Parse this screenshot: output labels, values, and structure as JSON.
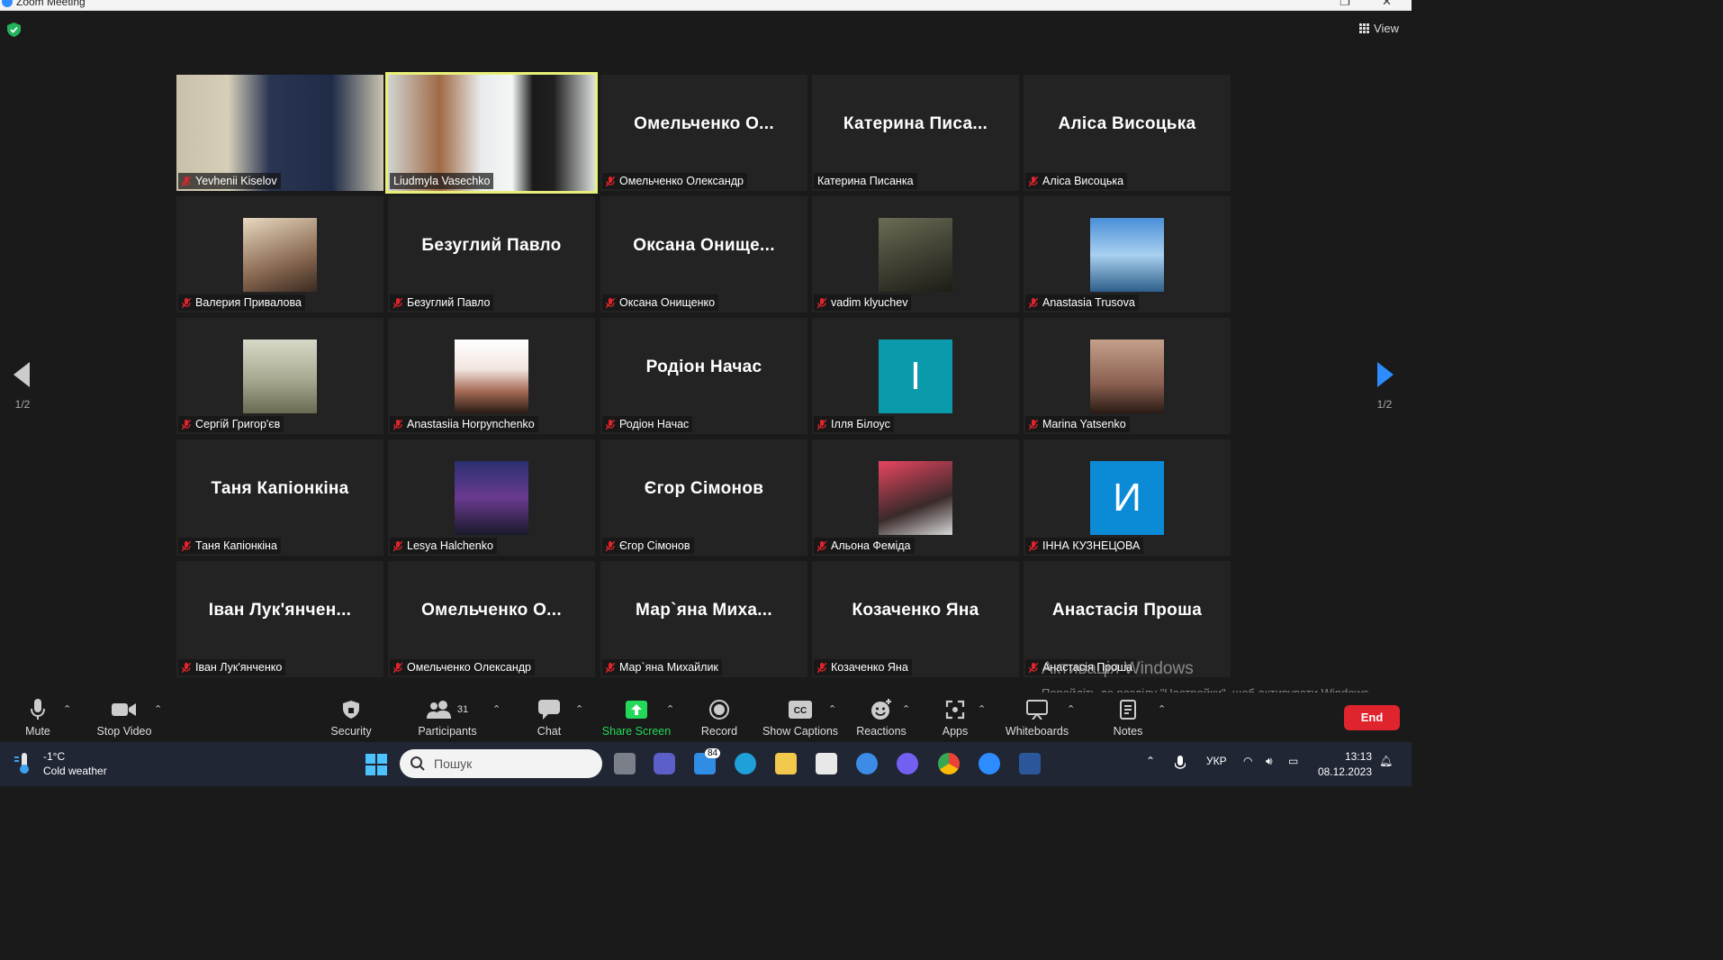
{
  "window": {
    "title": "Zoom Meeting"
  },
  "view_button": {
    "label": "View"
  },
  "pagination": {
    "left": "1/2",
    "right": "1/2"
  },
  "tiles": [
    {
      "display_name": "",
      "label": "Yevhenii Kiselov",
      "muted": true,
      "type": "video"
    },
    {
      "display_name": "",
      "label": "Liudmyla Vasechko",
      "muted": false,
      "type": "video",
      "active": true
    },
    {
      "display_name": "Омельченко  О...",
      "label": "Омельченко Олександр",
      "muted": true,
      "type": "name"
    },
    {
      "display_name": "Катерина  Писа...",
      "label": "Катерина Писанка",
      "muted": false,
      "type": "name"
    },
    {
      "display_name": "Аліса Висоцька",
      "label": "Аліса Висоцька",
      "muted": true,
      "type": "name"
    },
    {
      "display_name": "",
      "label": "Валерия Привалова",
      "muted": true,
      "type": "photo"
    },
    {
      "display_name": "Безуглий Павло",
      "label": "Безуглий Павло",
      "muted": true,
      "type": "name"
    },
    {
      "display_name": "Оксана  Онище...",
      "label": "Оксана Онищенко",
      "muted": true,
      "type": "name"
    },
    {
      "display_name": "",
      "label": "vadim klyuchev",
      "muted": true,
      "type": "photo"
    },
    {
      "display_name": "",
      "label": "Anastasia Trusova",
      "muted": true,
      "type": "photo"
    },
    {
      "display_name": "",
      "label": "Сергій Григор'єв",
      "muted": true,
      "type": "photo"
    },
    {
      "display_name": "",
      "label": "Anastasiia Horpynchenko",
      "muted": true,
      "type": "photo"
    },
    {
      "display_name": "Родіон Начас",
      "label": "Родіон Начас",
      "muted": true,
      "type": "name"
    },
    {
      "display_name": "І",
      "label": "Ілля Білоус",
      "muted": true,
      "type": "letter",
      "color": "#0a9aac"
    },
    {
      "display_name": "",
      "label": "Marina Yatsenko",
      "muted": true,
      "type": "photo"
    },
    {
      "display_name": "Таня Капіонкіна",
      "label": "Таня Капіонкіна",
      "muted": true,
      "type": "name"
    },
    {
      "display_name": "",
      "label": "Lesya Halchenko",
      "muted": true,
      "type": "photo"
    },
    {
      "display_name": "Єгор Сімонов",
      "label": "Єгор Сімонов",
      "muted": true,
      "type": "name"
    },
    {
      "display_name": "",
      "label": "Альона Феміда",
      "muted": true,
      "type": "photo"
    },
    {
      "display_name": "И",
      "label": "ІННА КУЗНЕЦОВА",
      "muted": true,
      "type": "letter",
      "color": "#0b8ad6"
    },
    {
      "display_name": "Іван  Лук'янчен...",
      "label": "Іван Лук'янченко",
      "muted": true,
      "type": "name"
    },
    {
      "display_name": "Омельченко  О...",
      "label": "Омельченко Олександр",
      "muted": true,
      "type": "name"
    },
    {
      "display_name": "Мар`яна  Миха...",
      "label": "Мар`яна Михайлик",
      "muted": true,
      "type": "name"
    },
    {
      "display_name": "Козаченко Яна",
      "label": "Козаченко Яна",
      "muted": true,
      "type": "name"
    },
    {
      "display_name": "Анастасія Проша",
      "label": "Анастасія Проша",
      "muted": true,
      "type": "name"
    }
  ],
  "toolbar": {
    "mute": "Mute",
    "stop_video": "Stop Video",
    "security": "Security",
    "participants": "Participants",
    "participants_count": "31",
    "chat": "Chat",
    "share_screen": "Share Screen",
    "record": "Record",
    "show_captions": "Show Captions",
    "reactions": "Reactions",
    "apps": "Apps",
    "whiteboards": "Whiteboards",
    "notes": "Notes",
    "end": "End"
  },
  "watermark": {
    "title": "Активація Windows",
    "text": "Перейдіть до розділу \"Настройки\", щоб активувати Windows."
  },
  "taskbar": {
    "temperature": "-1°C",
    "weather": "Cold weather",
    "search_placeholder": "Пошук",
    "mail_badge": "84",
    "language": "УКР",
    "time": "13:13",
    "date": "08.12.2023"
  },
  "colors": {
    "end_button": "#e0242d",
    "share_green": "#23d959",
    "active_border": "#e8f07a",
    "mute_red": "#e0242d"
  }
}
